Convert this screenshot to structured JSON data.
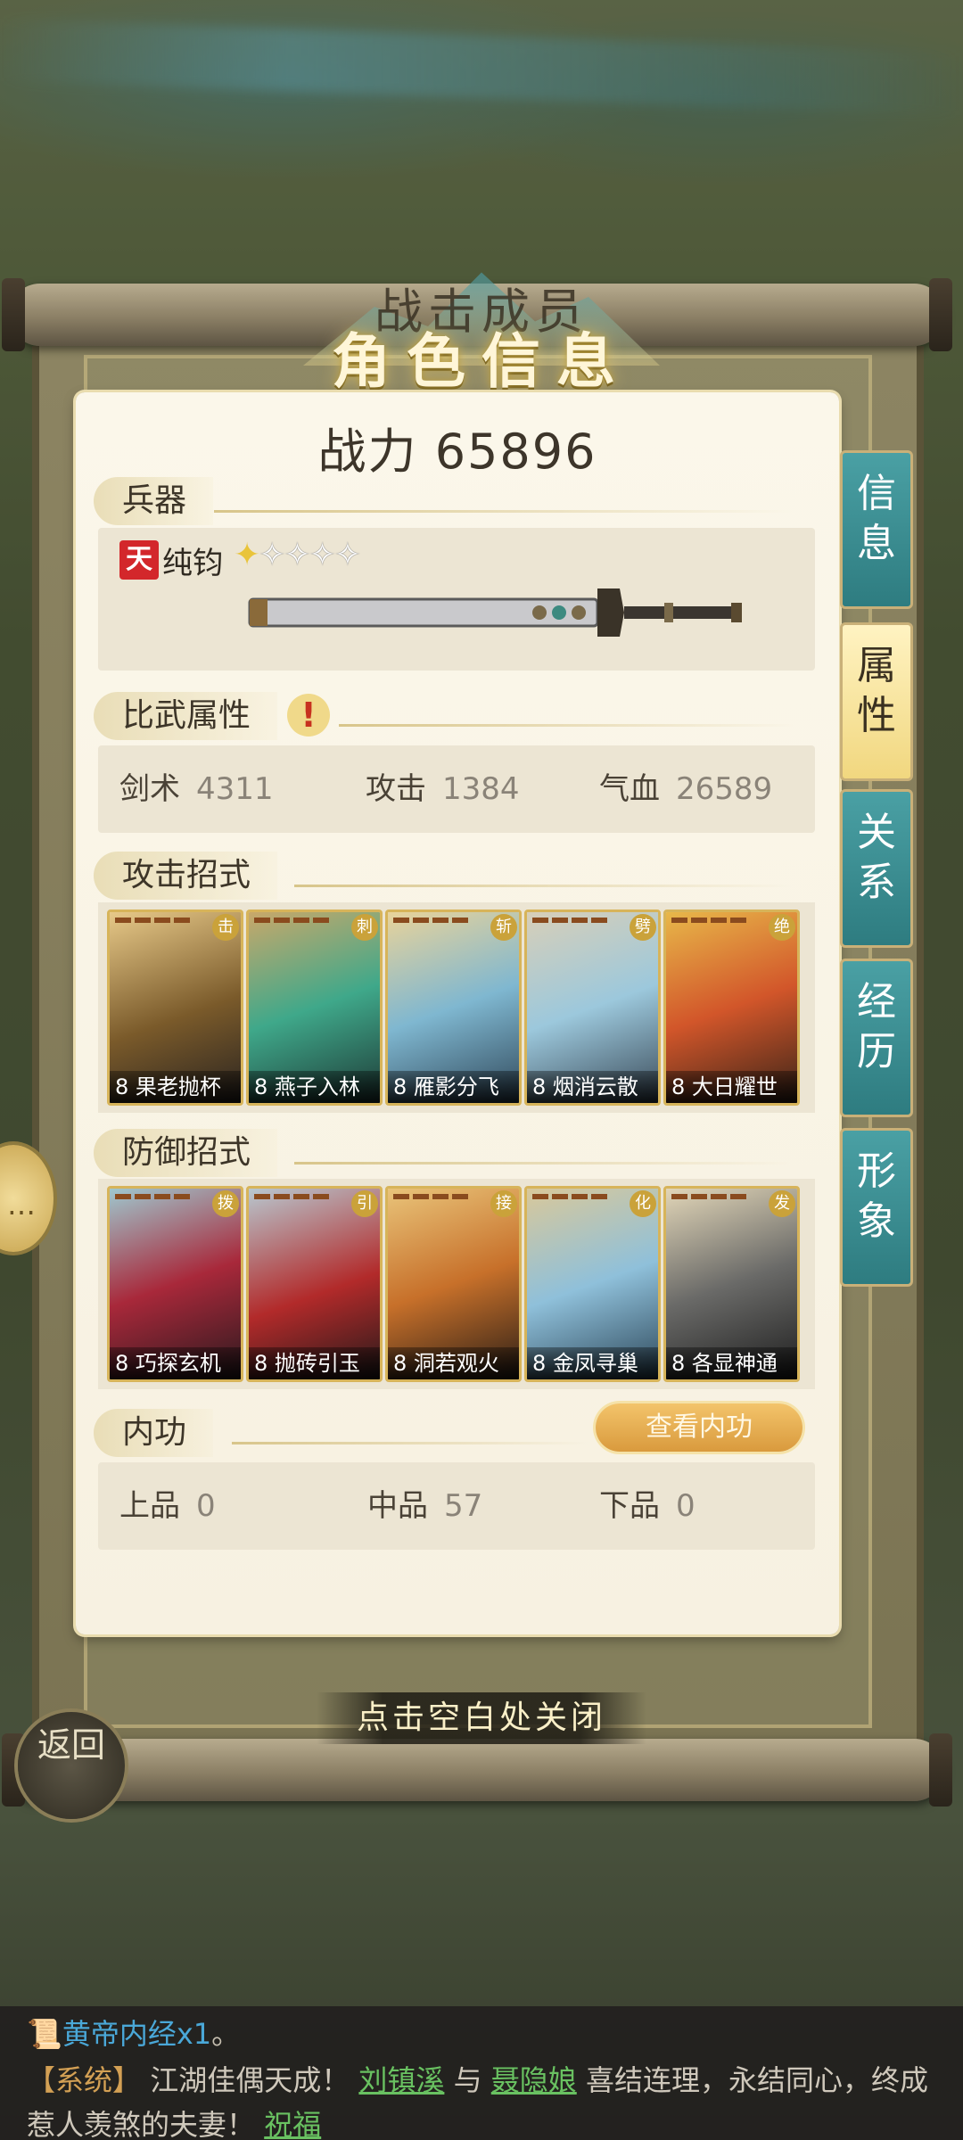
{
  "dialog": {
    "subtitle": "战击成员",
    "title": "角色信息",
    "power_label": "战力",
    "power_value": "65896"
  },
  "weapon": {
    "section": "兵器",
    "grade": "天",
    "name": "纯钧",
    "stars_filled": 1,
    "stars_total": 5
  },
  "combat_attrs": {
    "section": "比武属性",
    "alert": "!",
    "stats": [
      {
        "label": "剑术",
        "value": "4311"
      },
      {
        "label": "攻击",
        "value": "1384"
      },
      {
        "label": "气血",
        "value": "26589"
      }
    ]
  },
  "attack_moves": {
    "section": "攻击招式",
    "cards": [
      {
        "level": "8",
        "name": "果老抛杯",
        "tag": "击"
      },
      {
        "level": "8",
        "name": "燕子入林",
        "tag": "刺"
      },
      {
        "level": "8",
        "name": "雁影分飞",
        "tag": "斩"
      },
      {
        "level": "8",
        "name": "烟消云散",
        "tag": "劈"
      },
      {
        "level": "8",
        "name": "大日耀世",
        "tag": "绝"
      }
    ]
  },
  "defense_moves": {
    "section": "防御招式",
    "cards": [
      {
        "level": "8",
        "name": "巧探玄机",
        "tag": "拨"
      },
      {
        "level": "8",
        "name": "抛砖引玉",
        "tag": "引"
      },
      {
        "level": "8",
        "name": "洞若观火",
        "tag": "接"
      },
      {
        "level": "8",
        "name": "金凤寻巢",
        "tag": "化"
      },
      {
        "level": "8",
        "name": "各显神通",
        "tag": "发"
      }
    ]
  },
  "neigong": {
    "section": "内功",
    "button": "查看内功",
    "stats": [
      {
        "label": "上品",
        "value": "0"
      },
      {
        "label": "中品",
        "value": "57"
      },
      {
        "label": "下品",
        "value": "0"
      }
    ]
  },
  "side_tabs": [
    {
      "label": "信息",
      "active": false
    },
    {
      "label": "属性",
      "active": true
    },
    {
      "label": "关系",
      "active": false
    },
    {
      "label": "经历",
      "active": false
    },
    {
      "label": "形象",
      "active": false
    }
  ],
  "close_hint": "点击空白处关闭",
  "back_button": "返回",
  "chat": {
    "line1_item": "黄帝内经x1",
    "line1_end": "。",
    "system_tag": "【系统】",
    "msg_a": "江湖佳偶天成！",
    "name1": "刘镇溪",
    "conj": "与",
    "name2": "聂隐娘",
    "msg_b": "喜结连理，永结同心，终成惹人羡煞的夫妻！",
    "bless": "祝福"
  },
  "colors": {
    "teal_tab": "#2e7c80",
    "gold": "#d99a3d",
    "red_grade": "#d3272b",
    "link_green": "#69c161"
  }
}
